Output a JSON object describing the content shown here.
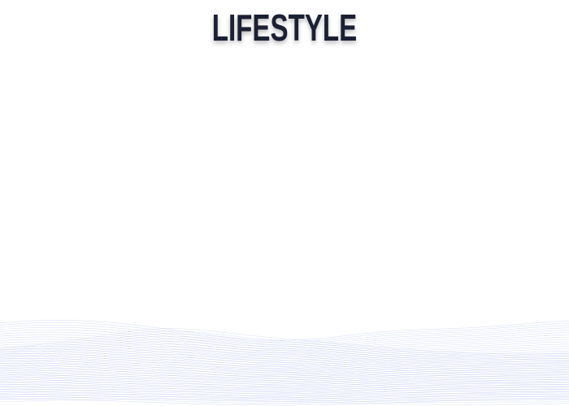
{
  "header": {
    "title": "LIFESTYLE"
  },
  "decoration": {
    "background_color": "#ffffff",
    "title_color": "#1b2033",
    "wave_color": "#8c9ee6",
    "wave_icon": "flowing-line-waves"
  }
}
